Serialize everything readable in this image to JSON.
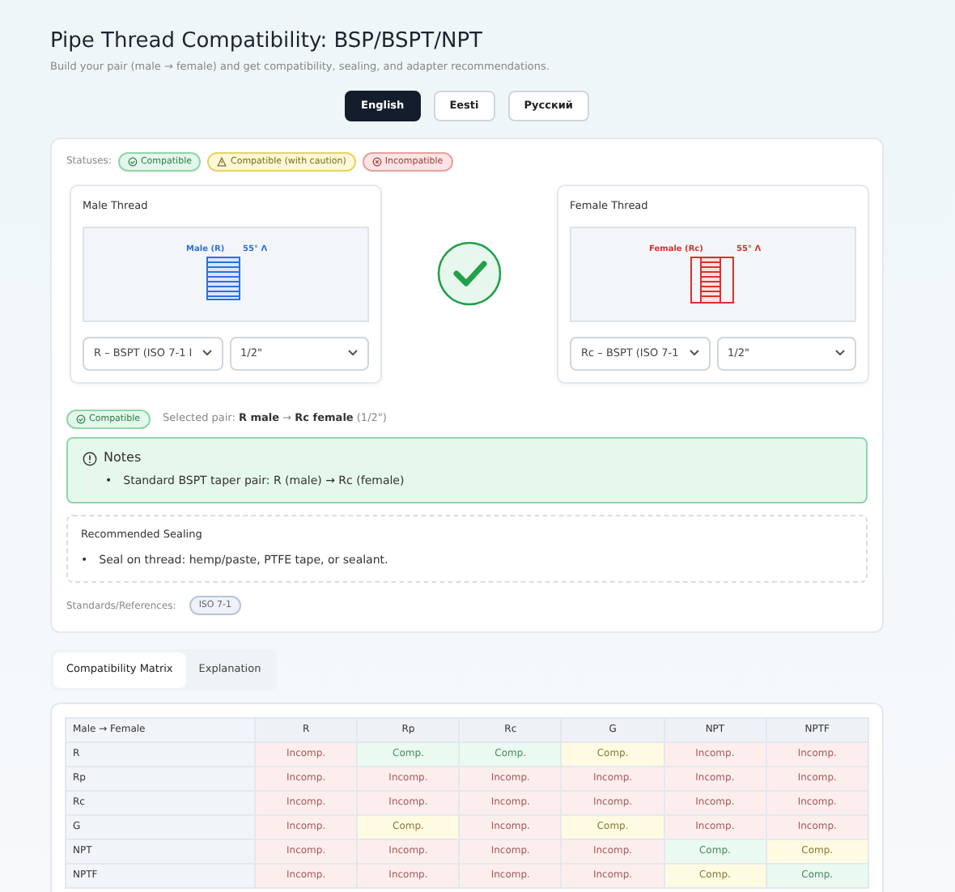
{
  "title": "Pipe Thread Compatibility: BSP/BSPT/NPT",
  "subtitle": "Build your pair (male → female) and get compatibility, sealing, and adapter recommendations.",
  "languages": [
    {
      "label": "English",
      "selected": true
    },
    {
      "label": "Eesti",
      "selected": false
    },
    {
      "label": "Русский",
      "selected": false
    }
  ],
  "statuses_label": "Statuses:",
  "statuses": [
    {
      "label": "Compatible",
      "kind": "ok"
    },
    {
      "label": "Compatible (with caution)",
      "kind": "caution"
    },
    {
      "label": "Incompatible",
      "kind": "bad"
    }
  ],
  "male": {
    "title": "Male Thread",
    "drawing_label": "Male (R)",
    "angle": "55° Λ",
    "type": "R – BSPT (ISO 7-1 I",
    "size": "1/2\""
  },
  "result": {
    "kind": "ok"
  },
  "female": {
    "title": "Female Thread",
    "drawing_label": "Female (Rc)",
    "angle": "55° Λ",
    "type": "Rc – BSPT (ISO 7-1",
    "size": "1/2\""
  },
  "pair": {
    "badge": "Compatible",
    "kind": "ok",
    "text": "Selected pair: **R male** → **Rc female** (1/2\")"
  },
  "notes": {
    "title": "Notes",
    "bullet": "•",
    "items": [
      "Standard BSPT taper pair: R (male) → Rc (female)"
    ]
  },
  "sealing": {
    "title": "Recommended Sealing",
    "bullet": "•",
    "items": [
      "Seal on thread: hemp/paste, PTFE tape, or sealant."
    ]
  },
  "standards": {
    "label": "Standards/References:",
    "items": [
      "ISO 7-1"
    ]
  },
  "tabs": [
    {
      "label": "Compatibility Matrix",
      "selected": true
    },
    {
      "label": "Explanation",
      "selected": false
    }
  ],
  "matrix": {
    "corner": "Male → Female",
    "columns": [
      "R",
      "Rp",
      "Rc",
      "G",
      "NPT",
      "NPTF"
    ],
    "rows": [
      {
        "label": "R",
        "cells": [
          {
            "text": "Incomp.",
            "kind": "bad"
          },
          {
            "text": "Comp.",
            "kind": "ok"
          },
          {
            "text": "Comp.",
            "kind": "ok"
          },
          {
            "text": "Comp.",
            "kind": "caution"
          },
          {
            "text": "Incomp.",
            "kind": "bad"
          },
          {
            "text": "Incomp.",
            "kind": "bad"
          }
        ]
      },
      {
        "label": "Rp",
        "cells": [
          {
            "text": "Incomp.",
            "kind": "bad"
          },
          {
            "text": "Incomp.",
            "kind": "bad"
          },
          {
            "text": "Incomp.",
            "kind": "bad"
          },
          {
            "text": "Incomp.",
            "kind": "bad"
          },
          {
            "text": "Incomp.",
            "kind": "bad"
          },
          {
            "text": "Incomp.",
            "kind": "bad"
          }
        ]
      },
      {
        "label": "Rc",
        "cells": [
          {
            "text": "Incomp.",
            "kind": "bad"
          },
          {
            "text": "Incomp.",
            "kind": "bad"
          },
          {
            "text": "Incomp.",
            "kind": "bad"
          },
          {
            "text": "Incomp.",
            "kind": "bad"
          },
          {
            "text": "Incomp.",
            "kind": "bad"
          },
          {
            "text": "Incomp.",
            "kind": "bad"
          }
        ]
      },
      {
        "label": "G",
        "cells": [
          {
            "text": "Incomp.",
            "kind": "bad"
          },
          {
            "text": "Comp.",
            "kind": "caution"
          },
          {
            "text": "Incomp.",
            "kind": "bad"
          },
          {
            "text": "Comp.",
            "kind": "caution"
          },
          {
            "text": "Incomp.",
            "kind": "bad"
          },
          {
            "text": "Incomp.",
            "kind": "bad"
          }
        ]
      },
      {
        "label": "NPT",
        "cells": [
          {
            "text": "Incomp.",
            "kind": "bad"
          },
          {
            "text": "Incomp.",
            "kind": "bad"
          },
          {
            "text": "Incomp.",
            "kind": "bad"
          },
          {
            "text": "Incomp.",
            "kind": "bad"
          },
          {
            "text": "Comp.",
            "kind": "ok"
          },
          {
            "text": "Comp.",
            "kind": "caution"
          }
        ]
      },
      {
        "label": "NPTF",
        "cells": [
          {
            "text": "Incomp.",
            "kind": "bad"
          },
          {
            "text": "Incomp.",
            "kind": "bad"
          },
          {
            "text": "Incomp.",
            "kind": "bad"
          },
          {
            "text": "Incomp.",
            "kind": "bad"
          },
          {
            "text": "Comp.",
            "kind": "caution"
          },
          {
            "text": "Comp.",
            "kind": "ok"
          }
        ]
      }
    ]
  }
}
